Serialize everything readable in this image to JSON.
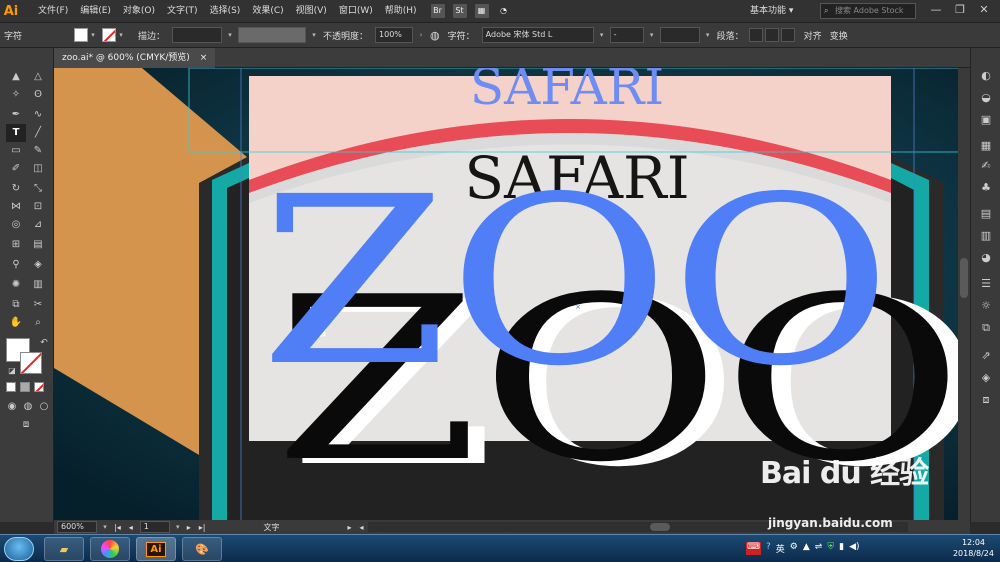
{
  "app": {
    "logo": "Ai"
  },
  "menu": [
    "文件(F)",
    "编辑(E)",
    "对象(O)",
    "文字(T)",
    "选择(S)",
    "效果(C)",
    "视图(V)",
    "窗口(W)",
    "帮助(H)"
  ],
  "menu_buttons": {
    "br": "Br",
    "st": "St"
  },
  "workspace": "基本功能",
  "stock_search_placeholder": "搜索 Adobe Stock",
  "control": {
    "type_label": "字符",
    "stroke_label": "描边：",
    "opacity_label": "不透明度：",
    "opacity_value": "100%",
    "char_label": "字符：",
    "font_value": "Adobe 宋体 Std L",
    "style_value": "-",
    "para_label": "段落：",
    "align_label": "对齐",
    "transform_label": "变换"
  },
  "document_tab": {
    "title": "zoo.ai* @ 600% (CMYK/预览)",
    "close": "×"
  },
  "canvas": {
    "safari_top": "SAFARI",
    "safari_mid": "SAFARI",
    "zoo_blue": "ZOO",
    "zoo_black": "ZOO",
    "zoo_white": "ZOO"
  },
  "status": {
    "zoom": "600%",
    "page": "1",
    "tool": "文字"
  },
  "taskbar": {
    "ai_label": "Ai",
    "time": "12:04",
    "date": "2018/8/24",
    "ime": "英"
  },
  "watermark": {
    "brand": "Bai du 经验",
    "url": "jingyan.baidu.com"
  },
  "colors": {
    "accent_pink": "#f4d2ca",
    "red_arc": "#e84c56",
    "teal": "#14a9a4",
    "blue_text": "#4f7ef7",
    "orange": "#d4944e"
  }
}
